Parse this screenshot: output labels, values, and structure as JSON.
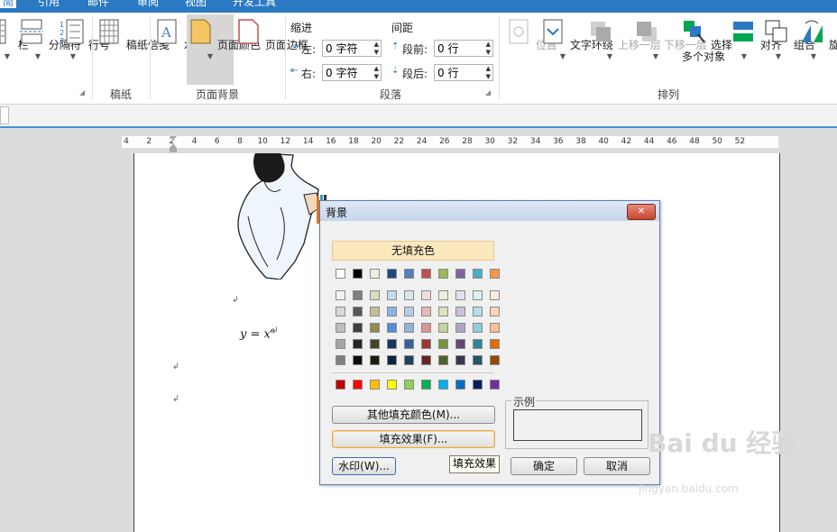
{
  "ribbon_tabs": [
    {
      "label": "简",
      "active": true
    },
    {
      "label": "引用"
    },
    {
      "label": "邮件"
    },
    {
      "label": "审阅"
    },
    {
      "label": "视图"
    },
    {
      "label": "开发工具"
    }
  ],
  "ribbon": {
    "buttons": {
      "columns": "栏",
      "breaks": "分隔符",
      "line_numbers": "行号",
      "manuscript": "稿纸信笺",
      "watermark": "水印",
      "page_color": "页面颜色",
      "page_borders": "页面边框",
      "position": "位置",
      "wrap_text": "文字环绕",
      "bring_forward": "上移一层",
      "send_backward": "下移一层",
      "select_objects_1": "选择",
      "select_objects_2": "多个对象",
      "align": "对齐",
      "group": "组合",
      "rotate": "旋转"
    },
    "groups": {
      "manuscript": "稿纸",
      "page_background": "页面背景",
      "paragraph": "段落",
      "arrange": "排列"
    },
    "paragraph": {
      "indent_heading": "缩进",
      "spacing_heading": "间距",
      "left_label": "左:",
      "right_label": "右:",
      "before_label": "段前:",
      "after_label": "段后:",
      "left_value": "0 字符",
      "right_value": "0 字符",
      "before_value": "0 行",
      "after_value": "0 行"
    }
  },
  "ruler_ticks": [
    "4",
    "2",
    "2",
    "4",
    "6",
    "8",
    "10",
    "12",
    "14",
    "16",
    "18",
    "20",
    "22",
    "24",
    "26",
    "28",
    "30",
    "32",
    "34",
    "36",
    "38",
    "40",
    "42",
    "44",
    "46",
    "48",
    "50",
    "52"
  ],
  "document": {
    "formula": "y = x",
    "formula_sup": "e",
    "para_mark": "↲"
  },
  "dialog": {
    "title": "背景",
    "close": "✕",
    "no_fill": "无填充色",
    "more_colors": "其他填充颜色(M)...",
    "fill_effects": "填充效果(F)...",
    "preview_label": "示例",
    "watermark": "水印(W)...",
    "ok": "确定",
    "cancel": "取消",
    "tooltip": "填充效果"
  },
  "palette": {
    "theme_row": [
      "#ffffff",
      "#000000",
      "#eeece1",
      "#1f497d",
      "#4f81bd",
      "#c0504d",
      "#9bbb59",
      "#8064a2",
      "#4bacc6",
      "#f79646"
    ],
    "shade_rows": [
      [
        "#f2f2f2",
        "#7f7f7f",
        "#ddd9c3",
        "#c6d9f0",
        "#dbe5f1",
        "#f2dcdb",
        "#ebf1dd",
        "#e5e0ec",
        "#dbeef3",
        "#fdeada"
      ],
      [
        "#d8d8d8",
        "#595959",
        "#c4bd97",
        "#8db3e2",
        "#b8cce4",
        "#e5b9b7",
        "#d7e3bc",
        "#ccc1d9",
        "#b7dde8",
        "#fbd5b5"
      ],
      [
        "#bfbfbf",
        "#3f3f3f",
        "#938953",
        "#548dd4",
        "#95b3d7",
        "#d99694",
        "#c3d69b",
        "#b2a2c7",
        "#92cddc",
        "#fac08f"
      ],
      [
        "#a5a5a5",
        "#262626",
        "#494429",
        "#17365d",
        "#366092",
        "#953734",
        "#76923c",
        "#5f497a",
        "#31859b",
        "#e36c09"
      ],
      [
        "#7f7f7f",
        "#0c0c0c",
        "#1d1b10",
        "#0f243e",
        "#244061",
        "#632423",
        "#4f6128",
        "#3f3151",
        "#205867",
        "#974806"
      ]
    ],
    "standard_row": [
      "#c00000",
      "#ff0000",
      "#ffc000",
      "#ffff00",
      "#92d050",
      "#00b050",
      "#00b0f0",
      "#0070c0",
      "#002060",
      "#7030a0"
    ]
  },
  "watermark_site": {
    "logo": "Bai du 经验",
    "url": "jingyan.baidu.com"
  }
}
